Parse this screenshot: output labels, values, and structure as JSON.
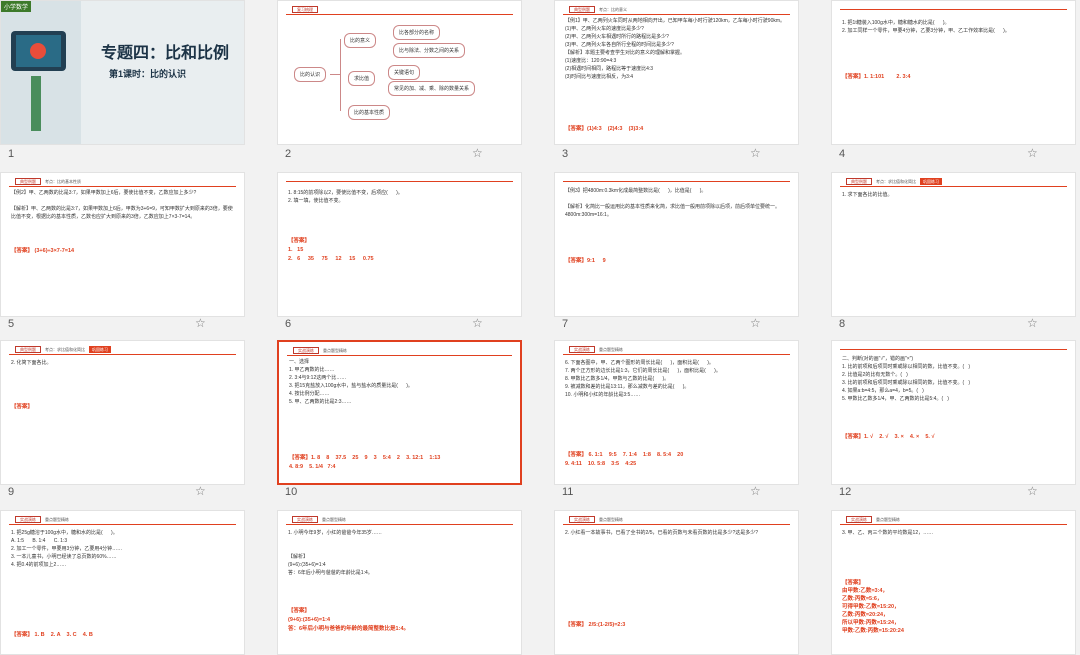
{
  "slides": [
    {
      "num": "1",
      "header": "",
      "body": "",
      "answer": "",
      "cover_title": "专题四：比和比例",
      "cover_sub": "第1课时：比的认识",
      "tag": "小学数学"
    },
    {
      "num": "2",
      "header": "复习梳理",
      "mm_root": "比的认识",
      "mm_b1": "比的意义",
      "mm_b2": "求比值",
      "mm_b3": "比的基本性质",
      "mm_l1": "比各部分的名称",
      "mm_l2": "比与除法、分数之间的关系",
      "mm_l3": "关键语句",
      "mm_l4": "常见的加、减、乘、除的数量关系"
    },
    {
      "num": "3",
      "header": "考点：比的意义",
      "body": "【例1】甲、乙两列火车同时从两地相向开出，已知甲车每小时行驶120km，乙车每小时行驶90km。\n(1)甲、乙两列火车的速度比是多少?\n(2)甲、乙两列火车相遇时所行的路程比是多少?\n(3)甲、乙两列火车各自所行全程的时间比是多少?\n【解析】本题主要考查学生对比的意义的理解和掌握。\n(1)速度比：120:90=4:3\n(2)相遇时间相同，路程比等于速度比4:3\n(3)时间比与速度比相反，为3:4",
      "answer": "【答案】(1)4:3    (2)4:3    (3)3:4"
    },
    {
      "num": "4",
      "header": "",
      "body": "1. 把1t糖装入100g水中，糖和糖水的比是(      )。\n2. 加工同样一个零件，甲要4分钟，乙要3分钟，甲、乙工作效率比是(      )。",
      "answer": "【答案】1. 1:101        2. 3:4"
    },
    {
      "num": "5",
      "header": "考点：比的基本性质",
      "body": "【例2】甲、乙两数的比是3:7，如果甲数加上6后，要使比值不变，乙数应加上多少?\n\n【解析】甲、乙两数的比是3:7，如果甲数加上6后，甲数为3+6=9，可知甲数扩大到原来的3倍，要使比值不变，根据比的基本性质，乙数也应扩大到原来的3倍，乙数应加上7×3-7=14。",
      "answer": "【答案】 (3+6)÷3×7-7=14"
    },
    {
      "num": "6",
      "header": "",
      "body": "1. 8:15的前项除以2，要使比值不变，后项应(      )。\n2. 填一填，使比值不变。",
      "answer": "【答案】\n1.   15\n2.   6     35     75     12     15     0.75"
    },
    {
      "num": "7",
      "header": "",
      "body": "【例3】把4800m:0.3km化成最简整数比是(      )，比值是(      )。\n\n【解析】化简比一般运用比的基本性质来化简，求比值一般用前项除以后项，前后项单位要统一。4800m:300m=16:1。",
      "answer": "【答案】9:1     9"
    },
    {
      "num": "8",
      "header": "考点：求比值和化简比",
      "body": "1. 求下面各比的比值。",
      "answer": ""
    },
    {
      "num": "9",
      "header": "考点：求比值和化简比",
      "body": "2. 化简下面各比。",
      "answer": "【答案】"
    },
    {
      "num": "10",
      "header": "重点题型精练",
      "body": "一、选择\n1. 甲乙两数的比……\n2. 3:4与9:12这两个比……\n3. 把15克盐放入100g水中，盐与盐水的质量比是(      )。\n4. 按比例分配……\n5. 甲、乙两数的比是2:3……",
      "answer": "【答案】1. 8    8    37.5    25    9    3    5:4    2    3. 12:1    1:13\n4. 8:9    5. 1/4   7:4"
    },
    {
      "num": "11",
      "header": "重点题型精练",
      "body": "6. 下面各图中，甲、乙两个图形的周长比是(      )，面积比是(      )。\n7. 两个正方形的边长比是1:3，它们的周长比是(      )，面积比是(      )。\n8. 甲数比乙数多1/4，甲数与乙数的比是(      )。\n9. 被减数和差的比是13:11，那么减数与差的比是(      )。\n10. 小明和小红的年龄比是3:5……",
      "answer": "【答案】 6. 1:1    9:5    7. 1:4    1:8    8. 5:4    20\n9. 4:11    10. 5:8    3:5    4:25"
    },
    {
      "num": "12",
      "header": "",
      "body": "二、判断(对的画\"√\"，错的画\"×\")\n1. 比的前项和后项同时乘或除以相同的数，比值不变。(   )\n2. 比值是2的比有无数个。(   )\n3. 比的前项和后项同时乘或除以相同的数，比值不变。(   )\n4. 如果a:b=4:5，那么a=4，b=5。(   )\n5. 甲数比乙数多1/4，甲、乙两数的比是5:4。(   )",
      "answer": "【答案】1. √    2. √    3. ×    4. ×    5. √"
    },
    {
      "num": "",
      "header": "重点题型精练",
      "body": "1. 把25g糖溶于100g水中，糖和水的比是(      )。\nA. 1:5      B. 1:4      C. 1:3\n2. 加工一个零件，甲要用3分钟，乙要用4分钟……\n3. 一本儿童书，小明已经读了总页数的60%……\n4. 把0.4的前项加上2……",
      "answer": "【答案】 1. B    2. A    3. C    4. B"
    },
    {
      "num": "",
      "header": "重点题型精练",
      "body": "1. 小明今年9岁，小红的爸爸今年35岁……\n\n\n【解析】\n(9+6):(35+6)=1:4\n答：6年后小明与爸爸的年龄比是1:4。",
      "answer": "【答案】\n(9+6):(35+6)=1:4\n答：6年后小明与爸爸的年龄的最简整数比是1:4。"
    },
    {
      "num": "",
      "header": "重点题型精练",
      "body": "2. 小红看一本故事书，已看了全书的2/5，已看的页数与未看页数的比是多少?这是多少?",
      "answer": "【答案】 2/5:(1-2/5)=2:3"
    },
    {
      "num": "",
      "header": "重点题型精练",
      "body": "3. 甲、乙、丙三个数的平均数是12，……",
      "answer": "【答案】\n由甲数:乙数=3:4，\n乙数:丙数=5:6，\n可得甲数:乙数=15:20，\n乙数:丙数=20:24，\n所以甲数:丙数=15:24，\n甲数:乙数:丙数=15:20:24"
    }
  ]
}
